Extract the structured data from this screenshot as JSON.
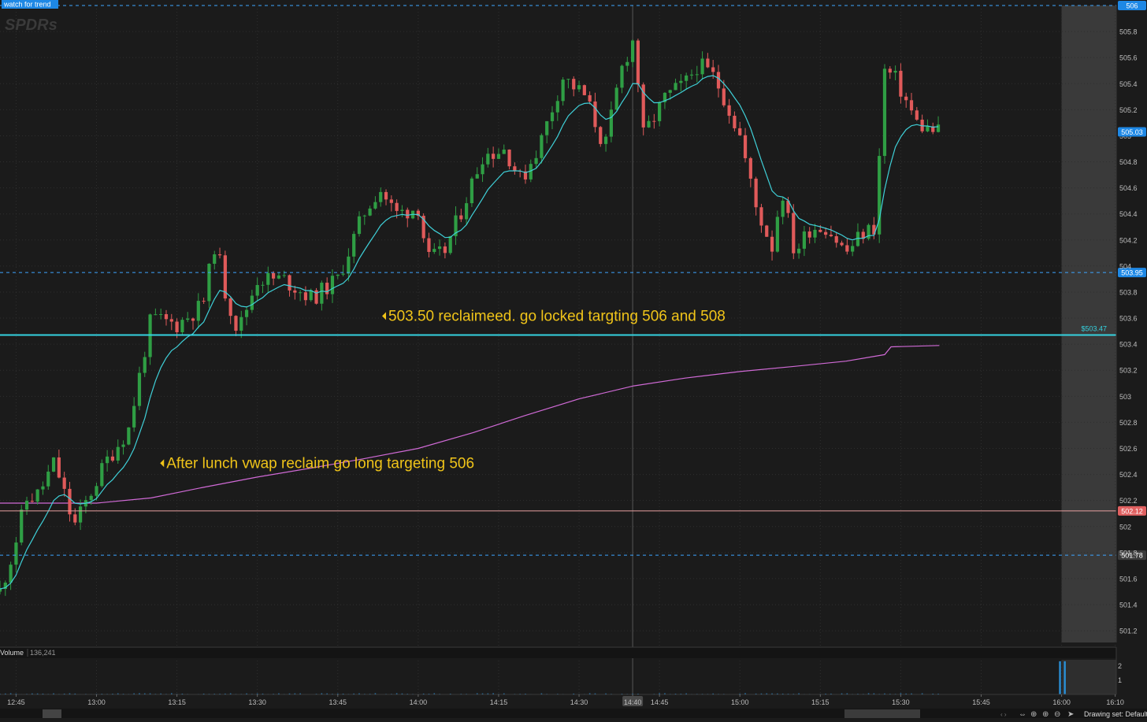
{
  "top_tag": "watch for trend",
  "watermark": "SPDRs",
  "chart_data": {
    "type": "candlestick",
    "x_ticks": [
      "12:45",
      "13:00",
      "13:15",
      "13:30",
      "13:45",
      "14:00",
      "14:15",
      "14:30",
      "14:40",
      "14:45",
      "15:00",
      "15:15",
      "15:30",
      "15:45",
      "16:00",
      "16:10"
    ],
    "x_range_minutes": [
      12.7,
      16.17
    ],
    "y_ticks": [
      "505.8",
      "505.6",
      "505.4",
      "505.2",
      "505",
      "504.8",
      "504.6",
      "504.4",
      "504.2",
      "504",
      "503.8",
      "503.6",
      "503.4",
      "503.2",
      "503",
      "502.8",
      "502.6",
      "502.4",
      "502.2",
      "502",
      "501.8",
      "501.6",
      "501.4",
      "501.2"
    ],
    "ylim": [
      501.11,
      506.0
    ],
    "after_hours_start": "16:00",
    "crosshair_time": "14:40",
    "price_levels": [
      {
        "label": "506",
        "value": 506.0,
        "style": "dashed",
        "color": "#3da5ff",
        "badge_bg": "#1e88e5",
        "badge_fg": "#ffffff"
      },
      {
        "label": "503.95",
        "value": 503.95,
        "style": "dashed",
        "color": "#3da5ff",
        "badge_bg": "#1e88e5",
        "badge_fg": "#ffffff"
      },
      {
        "label": "$503.47",
        "value": 503.47,
        "style": "solid",
        "color": "#35d3e0",
        "badge_bg": "none",
        "badge_fg": "#35d3e0"
      },
      {
        "label": "502.12",
        "value": 502.12,
        "style": "solid",
        "color": "#e8a0a0",
        "badge_bg": "#e06060",
        "badge_fg": "#ffffff"
      },
      {
        "label": "501.78",
        "value": 501.78,
        "style": "dashed",
        "color": "#3da5ff",
        "badge_bg": "#3a3a3a",
        "badge_fg": "#ffffff"
      }
    ],
    "last_price_label": "505.03",
    "last_price": 505.03,
    "annotations": [
      {
        "text": "503.50 reclaimeed. go locked targting 506 and 508",
        "time": 13.9,
        "price": 503.58
      },
      {
        "text": "After lunch vwap reclaim go long targeting 506",
        "time": 13.21,
        "price": 502.45
      }
    ],
    "price_anchors": [
      [
        12.7,
        501.5
      ],
      [
        12.74,
        501.8
      ],
      [
        12.78,
        502.2
      ],
      [
        12.82,
        502.25
      ],
      [
        12.87,
        502.5
      ],
      [
        12.93,
        502.0
      ],
      [
        12.97,
        502.2
      ],
      [
        13.03,
        502.5
      ],
      [
        13.1,
        502.75
      ],
      [
        13.17,
        503.6
      ],
      [
        13.25,
        503.55
      ],
      [
        13.33,
        503.7
      ],
      [
        13.37,
        504.2
      ],
      [
        13.4,
        503.8
      ],
      [
        13.44,
        503.5
      ],
      [
        13.5,
        503.9
      ],
      [
        13.58,
        503.9
      ],
      [
        13.67,
        503.75
      ],
      [
        13.75,
        503.9
      ],
      [
        13.83,
        504.4
      ],
      [
        13.88,
        504.6
      ],
      [
        13.93,
        504.4
      ],
      [
        14.0,
        504.45
      ],
      [
        14.03,
        504.05
      ],
      [
        14.08,
        504.1
      ],
      [
        14.13,
        504.4
      ],
      [
        14.2,
        504.85
      ],
      [
        14.27,
        504.9
      ],
      [
        14.32,
        504.65
      ],
      [
        14.38,
        504.95
      ],
      [
        14.45,
        505.45
      ],
      [
        14.52,
        505.3
      ],
      [
        14.58,
        504.9
      ],
      [
        14.63,
        505.5
      ],
      [
        14.67,
        505.75
      ],
      [
        14.7,
        505.0
      ],
      [
        14.77,
        505.3
      ],
      [
        14.83,
        505.4
      ],
      [
        14.87,
        505.55
      ],
      [
        14.92,
        505.45
      ],
      [
        14.95,
        505.3
      ],
      [
        15.0,
        505.0
      ],
      [
        15.05,
        504.45
      ],
      [
        15.1,
        504.15
      ],
      [
        15.13,
        504.6
      ],
      [
        15.17,
        504.1
      ],
      [
        15.22,
        504.3
      ],
      [
        15.27,
        504.3
      ],
      [
        15.33,
        504.1
      ],
      [
        15.38,
        504.25
      ],
      [
        15.42,
        504.3
      ],
      [
        15.45,
        505.5
      ],
      [
        15.48,
        505.45
      ],
      [
        15.52,
        505.25
      ],
      [
        15.55,
        505.1
      ],
      [
        15.58,
        505.05
      ],
      [
        15.62,
        505.03
      ]
    ],
    "vwap_anchors": [
      [
        12.7,
        502.18
      ],
      [
        13.0,
        502.18
      ],
      [
        13.17,
        502.22
      ],
      [
        13.33,
        502.3
      ],
      [
        13.5,
        502.38
      ],
      [
        13.67,
        502.45
      ],
      [
        13.83,
        502.52
      ],
      [
        14.0,
        502.6
      ],
      [
        14.17,
        502.72
      ],
      [
        14.33,
        502.85
      ],
      [
        14.5,
        502.98
      ],
      [
        14.67,
        503.08
      ],
      [
        14.83,
        503.14
      ],
      [
        15.0,
        503.19
      ],
      [
        15.17,
        503.23
      ],
      [
        15.33,
        503.27
      ],
      [
        15.45,
        503.32
      ],
      [
        15.47,
        503.38
      ],
      [
        15.62,
        503.39
      ]
    ],
    "volume": {
      "label": "Volume",
      "value": "136,241",
      "y_ticks": [
        "2",
        "1"
      ],
      "ylim": [
        0,
        2.4
      ]
    }
  },
  "footer": {
    "drawing_set": "Drawing set: Default"
  },
  "colors": {
    "up": "#2f9e44",
    "down": "#e05a5a",
    "ema": "#3fd0d8",
    "vwap": "#d06ad6",
    "volume": "#2a8fd6"
  }
}
